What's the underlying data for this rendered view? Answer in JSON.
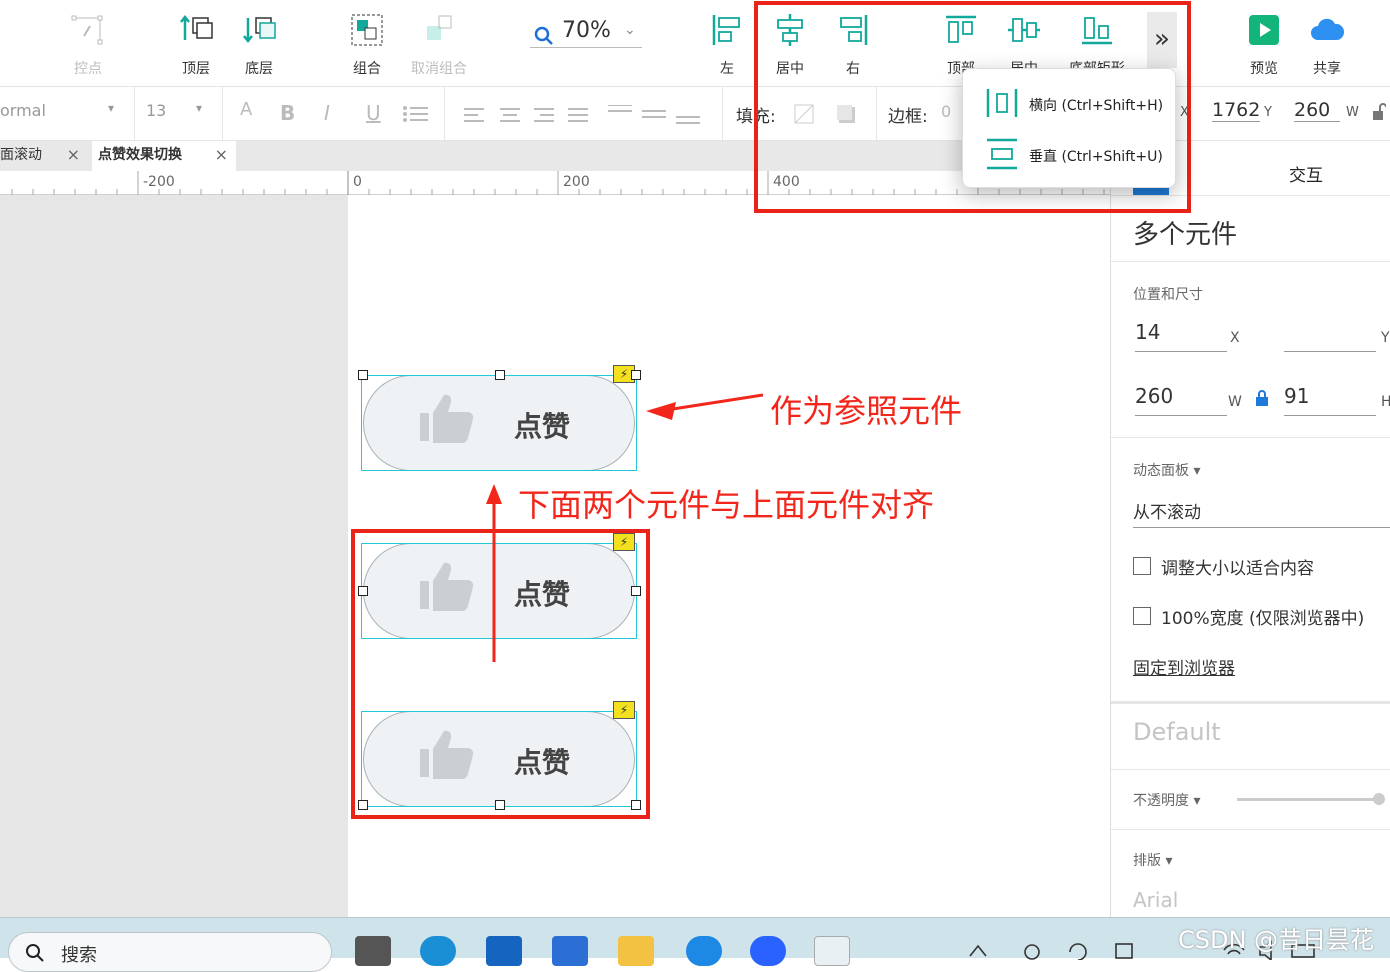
{
  "toolbar": {
    "control_points": "控点",
    "bring_front": "顶层",
    "send_back": "底层",
    "group": "组合",
    "ungroup": "取消组合",
    "zoom": "70%",
    "align_left": "左",
    "align_center": "居中",
    "align_right": "右",
    "align_top": "顶部",
    "align_middle": "居中",
    "align_bottom": "底部矩形",
    "more": "»",
    "preview": "预览",
    "share": "共享"
  },
  "formatbar": {
    "style_select": "ormal",
    "font_size": "13",
    "fill_label": "填充:",
    "border_label": "边框:",
    "border_value": "0",
    "x_label": "X",
    "x_value": "1762",
    "y_label": "Y",
    "w_value": "260",
    "w_label": "W"
  },
  "tabs": [
    {
      "label": "面滚动",
      "close": "×"
    },
    {
      "label": "点赞效果切换",
      "close": "×"
    }
  ],
  "ruler": {
    "labels": [
      "-200",
      "0",
      "200",
      "400"
    ]
  },
  "canvas": {
    "widget_label": "点赞",
    "annotation_reference": "作为参照元件",
    "annotation_align": "下面两个元件与上面元件对齐"
  },
  "dropdown": {
    "items": [
      {
        "label": "横向 (Ctrl+Shift+H)"
      },
      {
        "label": "垂直 (Ctrl+Shift+U)"
      }
    ]
  },
  "right_panel": {
    "tab_interaction": "交互",
    "title": "多个元件",
    "pos_size_label": "位置和尺寸",
    "x_value": "14",
    "x_unit": "X",
    "y_value": "",
    "y_unit": "Y",
    "w_value": "260",
    "w_unit": "W",
    "h_value": "91",
    "h_unit": "H",
    "dynamic_panel_label": "动态面板 ▾",
    "scroll_value": "从不滚动",
    "fit_content": "调整大小以适合内容",
    "full_width": "100%宽度 (仅限浏览器中)",
    "pin_browser": "固定到浏览器",
    "style_default": "Default",
    "opacity_label": "不透明度 ▾",
    "typography_label": "排版 ▾",
    "font_family_value": "Arial"
  },
  "taskbar": {
    "search_placeholder": "搜索",
    "watermark": "CSDN @昔日昙花"
  },
  "colors": {
    "accent": "#12a89a",
    "highlight_red": "#ea2318",
    "selection_cyan": "#22c7d8"
  }
}
